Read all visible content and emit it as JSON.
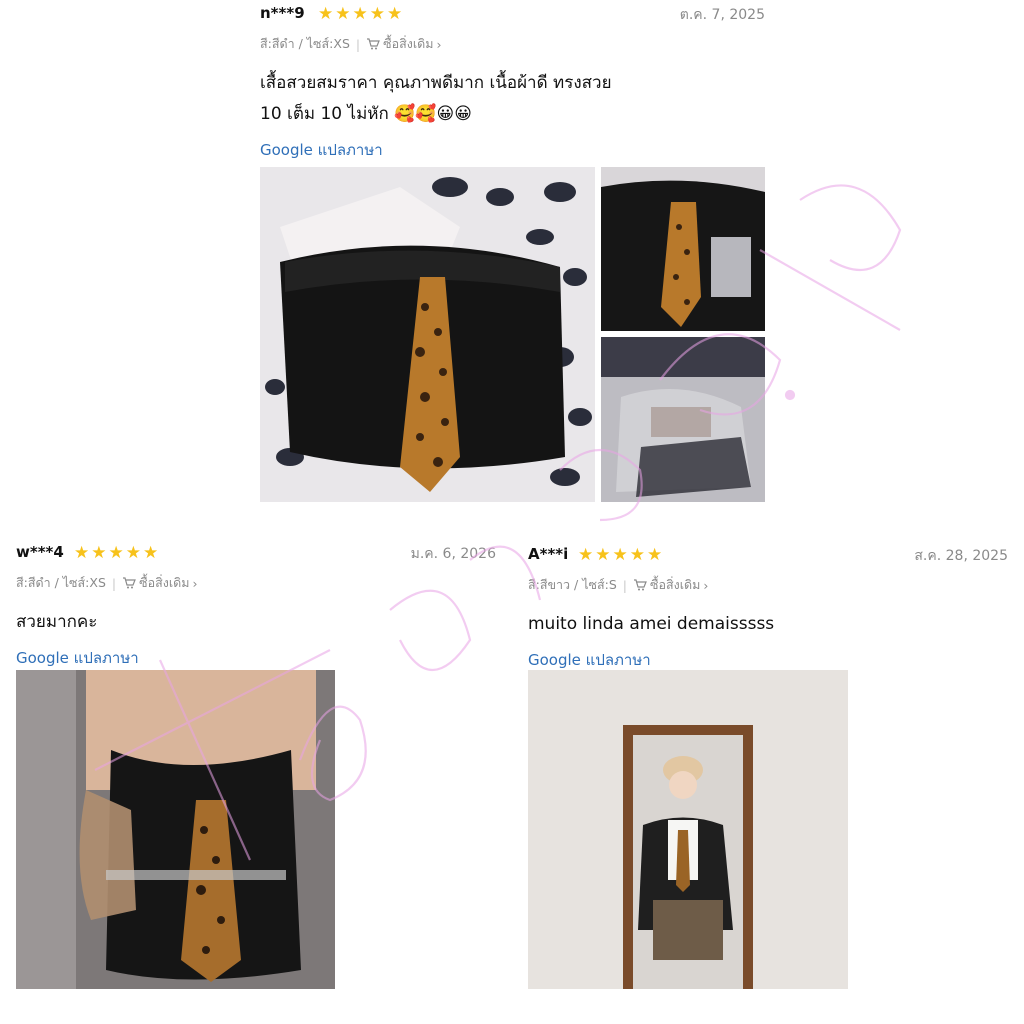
{
  "reviews": [
    {
      "user": "n***9",
      "stars": "★★★★★",
      "date": "ต.ค. 7, 2025",
      "variant": "สี:สีดำ / ไซส์:XS",
      "buy_again": "ซื้อสิ่งเดิม",
      "text_line1": "เสื้อสวยสมราคา คุณภาพดีมาก เนื้อผ้าดี ทรงสวย",
      "text_line2": "10 เต็ม 10 ไม่หัก 🥰🥰😀😀",
      "translate": "Google แปลภาษา"
    },
    {
      "user": "w***4",
      "stars": "★★★★★",
      "date": "ม.ค. 6, 2026",
      "variant": "สี:สีดำ / ไซส์:XS",
      "buy_again": "ซื้อสิ่งเดิม",
      "text_line1": "สวยมากคะ",
      "translate": "Google แปลภาษา"
    },
    {
      "user": "A***i",
      "stars": "★★★★★",
      "date": "ส.ค. 28, 2025",
      "variant": "สี:สีขาว / ไซส์:S",
      "buy_again": "ซื้อสิ่งเดิม",
      "text_line1": "muito linda amei demaisssss",
      "translate": "Google แปลภาษา"
    }
  ],
  "icons": {
    "star": "star-icon",
    "cart": "cart-icon",
    "chevron": "chevron-right-icon"
  },
  "colors": {
    "star": "#f7c21b",
    "link": "#2f6fb8",
    "muted": "#8a8a8a",
    "watermark": "#e9a3e6"
  }
}
